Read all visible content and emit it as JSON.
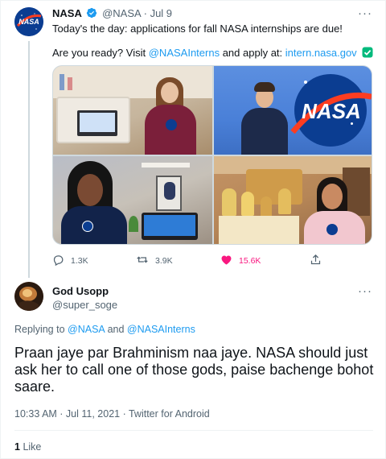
{
  "tweet": {
    "author_name": "NASA",
    "author_handle": "@NASA",
    "separator": "·",
    "date": "Jul 9",
    "more_label": "···",
    "line1": "Today's the day: applications for fall NASA internships are due!",
    "line2_prefix": "Are you ready? Visit",
    "mention": "@NASAInterns",
    "line2_middle": "and apply at:",
    "url": "intern.nasa.gov",
    "avatar_text": "NASA",
    "photo_logo_text": "NASA",
    "actions": {
      "reply": "1.3K",
      "retweet": "3.9K",
      "like": "15.6K"
    }
  },
  "reply": {
    "author_name": "God Usopp",
    "author_handle": "@super_soge",
    "more_label": "···",
    "replying_prefix": "Replying to",
    "replying_mention_1": "@NASA",
    "replying_and": "and",
    "replying_mention_2": "@NASAInterns",
    "text": "Praan jaye par Brahminism naa jaye. NASA should just ask her to call one of those gods, paise bachenge bohot saare.",
    "timestamp": "10:33 AM · Jul 11, 2021 · Twitter for Android",
    "like_count": "1",
    "like_label": "Like"
  },
  "colors": {
    "link": "#1d9bf0",
    "muted": "#536471",
    "like_pink": "#f91880",
    "verified_blue": "#1d9bf0",
    "check_green": "#00ba7c",
    "nasa_blue": "#0b3d91"
  },
  "icons": [
    "verified-badge-icon",
    "more-icon",
    "check-mark-icon",
    "reply-icon",
    "retweet-icon",
    "heart-icon",
    "share-icon"
  ]
}
